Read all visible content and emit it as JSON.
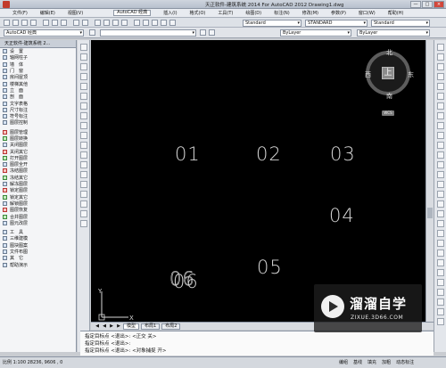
{
  "window": {
    "title": "天正软件-建筑系统 2014  For AutoCAD 2012    Drawing1.dwg",
    "buttons": [
      "—",
      "□",
      "×"
    ]
  },
  "menubar": {
    "items": [
      "文件(F)",
      "编辑(E)",
      "视图(V)",
      "插入(I)",
      "格式(O)",
      "工具(T)",
      "绘图(D)",
      "标注(N)",
      "修改(M)",
      "参数(P)",
      "窗口(W)",
      "帮助(H)"
    ],
    "workspace": "AutoCAD 经典"
  },
  "toolbar": {
    "workspace_combo": "AutoCAD 经典",
    "layer_combo": "ByLayer",
    "linetype_combo": "ByLayer",
    "text_style": "Standard",
    "dim_style": "STANDARD",
    "table_style": "Standard"
  },
  "left_panel": {
    "title": "天正软件-建筑系统 2...",
    "items": [
      {
        "label": "设　置",
        "icon": "folder-icon"
      },
      {
        "label": "轴网柱子",
        "icon": "folder-icon"
      },
      {
        "label": "墙　体",
        "icon": "folder-icon"
      },
      {
        "label": "门　窗",
        "icon": "folder-icon"
      },
      {
        "label": "房间屋顶",
        "icon": "folder-icon"
      },
      {
        "label": "楼梯其他",
        "icon": "folder-icon"
      },
      {
        "label": "立　面",
        "icon": "folder-icon"
      },
      {
        "label": "剖　面",
        "icon": "folder-icon"
      },
      {
        "label": "文字表格",
        "icon": "folder-icon"
      },
      {
        "label": "尺寸标注",
        "icon": "folder-icon"
      },
      {
        "label": "符号标注",
        "icon": "folder-icon"
      },
      {
        "label": "图层控制",
        "icon": "folder-icon"
      },
      {
        "label": "图层管理",
        "icon": "layer-icon"
      },
      {
        "label": "图层转换",
        "icon": "layer-icon"
      },
      {
        "label": "关闭图层",
        "icon": "layer-icon"
      },
      {
        "label": "关闭其它",
        "icon": "layer-icon"
      },
      {
        "label": "打开图层",
        "icon": "layer-icon"
      },
      {
        "label": "图层全开",
        "icon": "layer-icon"
      },
      {
        "label": "冻结图层",
        "icon": "layer-icon"
      },
      {
        "label": "冻结其它",
        "icon": "layer-icon"
      },
      {
        "label": "解冻图层",
        "icon": "layer-icon"
      },
      {
        "label": "锁定图层",
        "icon": "layer-icon"
      },
      {
        "label": "锁定其它",
        "icon": "layer-icon"
      },
      {
        "label": "解锁图层",
        "icon": "layer-icon"
      },
      {
        "label": "图层恢复",
        "icon": "layer-icon"
      },
      {
        "label": "合并图层",
        "icon": "layer-icon"
      },
      {
        "label": "图元改层",
        "icon": "layer-icon"
      },
      {
        "label": "工　具",
        "icon": "folder-icon"
      },
      {
        "label": "三维建模",
        "icon": "folder-icon"
      },
      {
        "label": "图块图案",
        "icon": "folder-icon"
      },
      {
        "label": "文件布图",
        "icon": "folder-icon"
      },
      {
        "label": "其　它",
        "icon": "folder-icon"
      },
      {
        "label": "帮助演示",
        "icon": "folder-icon"
      }
    ]
  },
  "canvas": {
    "background": "#000000",
    "labels": [
      "01",
      "02",
      "03",
      "04",
      "05",
      "06",
      "06"
    ],
    "viewcube": {
      "top": "北",
      "bottom": "南",
      "left": "西",
      "right": "东",
      "face": "上",
      "wcs": "WCS"
    },
    "ucs": {
      "x": "X",
      "y": "Y"
    }
  },
  "tabs": {
    "nav": [
      "◀",
      "◀",
      "▶",
      "▶"
    ],
    "items": [
      "模型",
      "布局1",
      "布局2"
    ]
  },
  "command_line": {
    "lines": [
      "指定目标点 <退出>: <正交 关>",
      "指定目标点 <退出>:",
      "指定目标点 <退出>: <对象捕捉 开>"
    ]
  },
  "status_bar": {
    "coords": "比例 1:100  28236, 9606 , 0",
    "toggles": [
      "编组",
      "基线",
      "填充",
      "加粗",
      "动态标注"
    ]
  },
  "watermark": {
    "title": "溜溜自学",
    "url": "ZIXUE.3D66.COM"
  }
}
